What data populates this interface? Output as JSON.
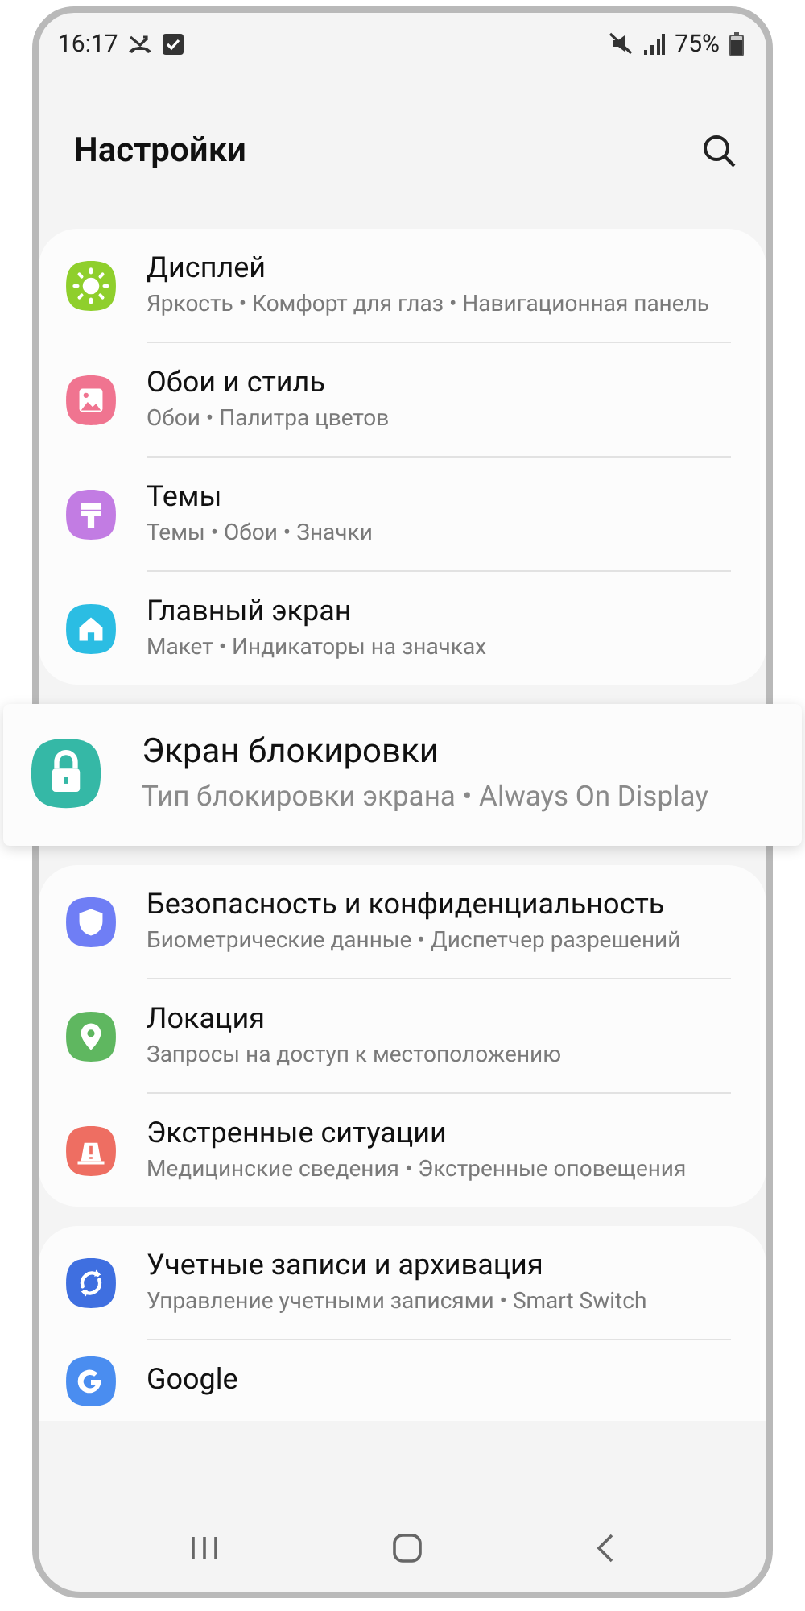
{
  "status_bar": {
    "time": "16:17",
    "battery": "75%"
  },
  "header": {
    "title": "Настройки"
  },
  "sections": [
    {
      "kind": "card",
      "items": [
        {
          "title": "Дисплей",
          "subtitle": "Яркость • Комфорт для глаз • Навигационная панель",
          "color": "#8fcf2c"
        },
        {
          "title": "Обои и стиль",
          "subtitle": "Обои • Палитра цветов",
          "color": "#f07490"
        },
        {
          "title": "Темы",
          "subtitle": "Темы • Обои • Значки",
          "color": "#c27ce3"
        },
        {
          "title": "Главный экран",
          "subtitle": "Макет • Индикаторы на значках",
          "color": "#2bbde3"
        }
      ]
    },
    {
      "kind": "callout",
      "items": [
        {
          "title": "Экран блокировки",
          "subtitle": "Тип блокировки экрана • Always On Display",
          "color": "#35b8a6"
        }
      ]
    },
    {
      "kind": "card",
      "items": [
        {
          "title": "Безопасность и конфиденциальность",
          "subtitle": "Биометрические данные • Диспетчер разрешений",
          "color": "#6f7ef5"
        },
        {
          "title": "Локация",
          "subtitle": "Запросы на доступ к местоположению",
          "color": "#5fb760"
        },
        {
          "title": "Экстренные ситуации",
          "subtitle": "Медицинские сведения • Экстренные оповещения",
          "color": "#ee6e62"
        }
      ]
    },
    {
      "kind": "card",
      "items": [
        {
          "title": "Учетные записи и архивация",
          "subtitle": "Управление учетными записями • Smart Switch",
          "color": "#3f6fe0"
        },
        {
          "title": "Google",
          "color": "#4a8df0"
        }
      ]
    }
  ]
}
